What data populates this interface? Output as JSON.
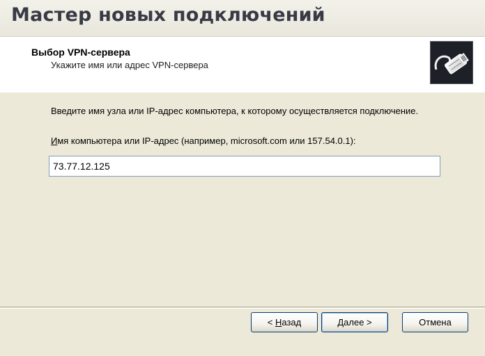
{
  "window": {
    "title": "Мастер новых подключений"
  },
  "header": {
    "title": "Выбор VPN-сервера",
    "subtitle": "Укажите имя или адрес VPN-сервера",
    "icon": "network-plug-icon"
  },
  "content": {
    "instruction": "Введите имя узла или IP-адрес компьютера, к  которому осуществляется подключение.",
    "field_label_accel": "И",
    "field_label_rest": "мя компьютера или IP-адрес (например, microsoft.com или 157.54.0.1):",
    "host_value": "73.77.12.125"
  },
  "buttons": {
    "back_prefix": "< ",
    "back_accel": "Н",
    "back_rest": "азад",
    "next_accel": "Д",
    "next_rest": "алее >",
    "cancel_label": "Отмена"
  }
}
